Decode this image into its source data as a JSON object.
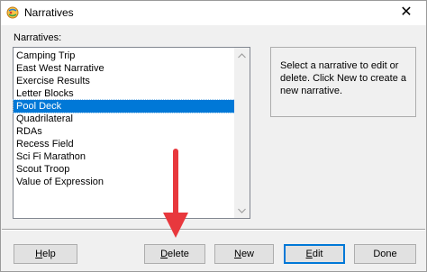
{
  "window": {
    "title": "Narratives",
    "app_icon": "globe-icon",
    "close_glyph": "✕"
  },
  "list": {
    "label": "Narratives:",
    "items": [
      "Camping Trip",
      "East West Narrative",
      "Exercise Results",
      "Letter Blocks",
      "Pool Deck",
      "Quadrilateral",
      "RDAs",
      "Recess Field",
      "Sci Fi Marathon",
      "Scout Troop",
      "Value of Expression"
    ],
    "selected_index": 4
  },
  "description": "Select a narrative to edit or delete.  Click New to create a new narrative.",
  "buttons": {
    "help": {
      "label": "Help",
      "accel": "H",
      "rest": "elp"
    },
    "delete": {
      "label": "Delete",
      "accel": "D",
      "rest": "elete"
    },
    "new": {
      "label": "New",
      "accel": "N",
      "rest": "ew"
    },
    "edit": {
      "label": "Edit",
      "accel": "E",
      "rest": "dit"
    },
    "done": {
      "label": "Done",
      "accel": "",
      "rest": "Done"
    }
  },
  "annotation": {
    "arrow_color": "#e8383d",
    "points_to": "delete-button"
  },
  "colors": {
    "selection": "#0078d7",
    "default_button_border": "#0078d7"
  }
}
